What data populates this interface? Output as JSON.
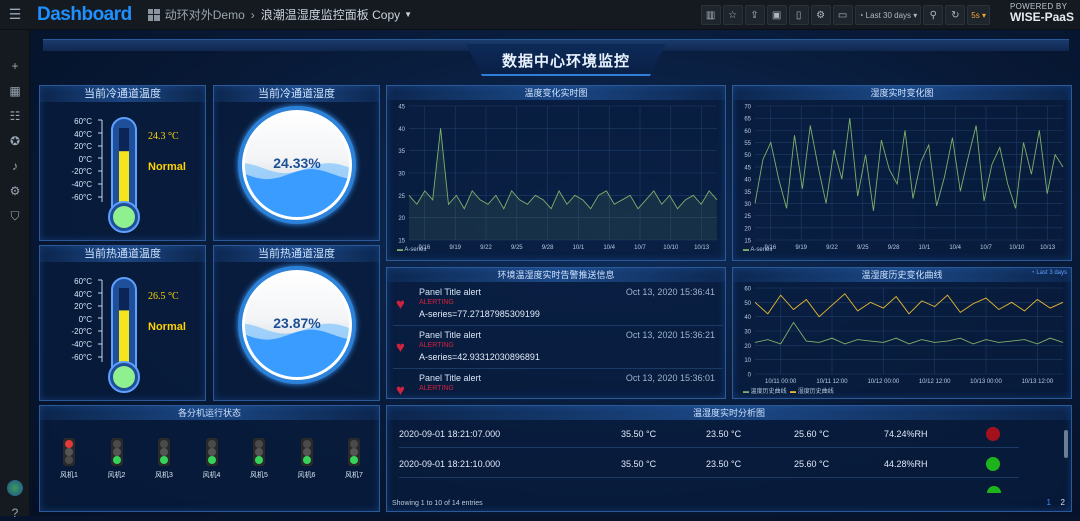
{
  "header": {
    "logo": "Dashboard",
    "folder": "动环对外Demo",
    "separator": "›",
    "dashboard_title": "浪潮温湿度监控面板 Copy",
    "time_range": "Last 30 days",
    "refresh": "5s",
    "brand_top": "POWERED BY",
    "brand_name": "WISE-PaaS"
  },
  "main_title": "数据中心环境监控",
  "panels": {
    "cold_temp": {
      "title": "当前冷通道温度",
      "value": "24.3 °C",
      "status": "Normal",
      "ticks": [
        "60°C",
        "40°C",
        "20°C",
        "0°C",
        "-20°C",
        "-40°C",
        "-60°C"
      ],
      "fill_fraction": 0.71
    },
    "cold_hum": {
      "title": "当前冷通道湿度",
      "value": "24.33%",
      "fill_fraction": 0.2433
    },
    "hot_temp": {
      "title": "当前热通道温度",
      "value": "26.5 °C",
      "status": "Normal",
      "ticks": [
        "60°C",
        "40°C",
        "20°C",
        "0°C",
        "-20°C",
        "-40°C",
        "-60°C"
      ],
      "fill_fraction": 0.72
    },
    "hot_hum": {
      "title": "当前热通道湿度",
      "value": "23.87%",
      "fill_fraction": 0.2387
    },
    "fans": {
      "title": "各分机运行状态",
      "items": [
        {
          "label": "风机1",
          "state": "red"
        },
        {
          "label": "风机2",
          "state": "green"
        },
        {
          "label": "风机3",
          "state": "green"
        },
        {
          "label": "风机4",
          "state": "green"
        },
        {
          "label": "风机5",
          "state": "green"
        },
        {
          "label": "风机6",
          "state": "green"
        },
        {
          "label": "风机7",
          "state": "green"
        }
      ]
    },
    "temp_chart": {
      "title": "温度变化实时图",
      "legend": "A-series"
    },
    "hum_chart": {
      "title": "湿度实时变化图",
      "legend": "A-series"
    },
    "alerts": {
      "title": "环境温湿度实时告警推送信息",
      "items": [
        {
          "name": "Panel Title alert",
          "state": "ALERTING",
          "value": "A-series=77.27187985309199",
          "time": "Oct 13, 2020 15:36:41"
        },
        {
          "name": "Panel Title alert",
          "state": "ALERTING",
          "value": "A-series=42.93312030896891",
          "time": "Oct 13, 2020 15:36:21"
        },
        {
          "name": "Panel Title alert",
          "state": "ALERTING",
          "value": "",
          "time": "Oct 13, 2020 15:36:01"
        }
      ]
    },
    "history": {
      "title": "温湿度历史变化曲线",
      "badge": "Last 3 days",
      "legend_a": "温度历史曲线",
      "legend_b": "湿度历史曲线"
    },
    "table": {
      "title": "温湿度实时分析图",
      "rows": [
        {
          "time": "2020-09-01 18:21:07.000",
          "a": "35.50 °C",
          "b": "23.50 °C",
          "c": "25.60 °C",
          "rh": "74.24%RH",
          "status": "red"
        },
        {
          "time": "2020-09-01 18:21:10.000",
          "a": "35.50 °C",
          "b": "23.50 °C",
          "c": "25.60 °C",
          "rh": "44.28%RH",
          "status": "green"
        }
      ],
      "footer": "Showing 1 to 10 of 14 entries",
      "pages": [
        "1",
        "2"
      ]
    }
  },
  "chart_data": [
    {
      "type": "line",
      "title": "温度变化实时图",
      "categories": [
        "9/16",
        "9/19",
        "9/22",
        "9/25",
        "9/28",
        "10/1",
        "10/4",
        "10/7",
        "10/10",
        "10/13"
      ],
      "ylim": [
        15,
        45
      ],
      "yticks": [
        "45",
        "40",
        "35",
        "30",
        "25",
        "20",
        "15"
      ],
      "series": [
        {
          "name": "A-series",
          "values": [
            25,
            23,
            26,
            24,
            40,
            23,
            25,
            22,
            26,
            24,
            23,
            25,
            22,
            26,
            24,
            23,
            25,
            24,
            22,
            26,
            23,
            25,
            24,
            22,
            25,
            26,
            23,
            24,
            25,
            22,
            24,
            26,
            23,
            25,
            22,
            24,
            25,
            23,
            26,
            24
          ]
        }
      ]
    },
    {
      "type": "line",
      "title": "湿度实时变化图",
      "categories": [
        "9/16",
        "9/19",
        "9/22",
        "9/25",
        "9/28",
        "10/1",
        "10/4",
        "10/7",
        "10/10",
        "10/13"
      ],
      "ylim": [
        15,
        70
      ],
      "yticks": [
        "70",
        "65",
        "60",
        "55",
        "50",
        "45",
        "40",
        "35",
        "30",
        "25",
        "20",
        "15"
      ],
      "series": [
        {
          "name": "A-series",
          "values": [
            30,
            48,
            55,
            40,
            28,
            58,
            36,
            62,
            45,
            30,
            52,
            40,
            65,
            33,
            50,
            27,
            56,
            44,
            38,
            60,
            32,
            47,
            54,
            29,
            41,
            57,
            35,
            49,
            62,
            31,
            46,
            53,
            38,
            28,
            55,
            42,
            60,
            34,
            50,
            45
          ]
        }
      ]
    },
    {
      "type": "line",
      "title": "温湿度历史变化曲线",
      "categories": [
        "10/11 00:00",
        "10/11 12:00",
        "10/12 00:00",
        "10/12 12:00",
        "10/13 00:00",
        "10/13 12:00"
      ],
      "ylim": [
        0,
        60
      ],
      "yticks": [
        "60",
        "50",
        "40",
        "30",
        "20",
        "10",
        "0"
      ],
      "series": [
        {
          "name": "温度历史曲线",
          "values": [
            22,
            24,
            21,
            36,
            23,
            22,
            25,
            21,
            24,
            23,
            22,
            25,
            21,
            24,
            22,
            23,
            25,
            21,
            24,
            22,
            23,
            24,
            21,
            25,
            22
          ]
        },
        {
          "name": "湿度历史曲线",
          "values": [
            50,
            42,
            55,
            45,
            52,
            40,
            48,
            56,
            44,
            50,
            46,
            54,
            42,
            51,
            47,
            55,
            43,
            49,
            53,
            45,
            50,
            44,
            52,
            46,
            50
          ]
        }
      ]
    }
  ],
  "colors": {
    "accent": "#2f7fd8",
    "series_green": "#7fb069",
    "series_yellow": "#e8b931",
    "alert_red": "#d0223f",
    "ok_green": "#1db31d",
    "bad_red": "#a3121c"
  }
}
